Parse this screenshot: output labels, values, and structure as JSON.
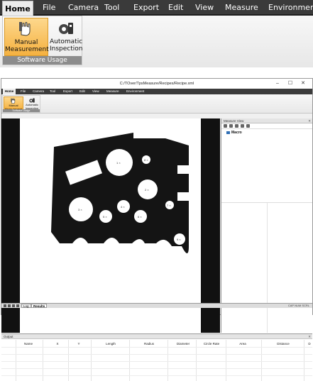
{
  "zoom": {
    "menu": [
      "Home",
      "File",
      "Camera",
      "Tool",
      "Export",
      "Edit",
      "View",
      "Measure",
      "Environment"
    ],
    "buttons": [
      {
        "label1": "Manual",
        "label2": "Measurement",
        "selected": true,
        "icon": "hand-measure-icon"
      },
      {
        "label1": "Automatic",
        "label2": "Inspection",
        "selected": false,
        "icon": "gear-camera-icon"
      }
    ],
    "group_label": "Software Usage"
  },
  "window": {
    "title": "C:/TOver/TpsMeasure/Recipes/Recipe.xml",
    "controls": [
      "–",
      "☐",
      "✕"
    ]
  },
  "menu": [
    "Home",
    "File",
    "Camera",
    "Tool",
    "Export",
    "Edit",
    "View",
    "Measure",
    "Environment"
  ],
  "ribbon": {
    "buttons": [
      {
        "label1": "Manual",
        "label2": "Measurement",
        "selected": true
      },
      {
        "label1": "Automatic",
        "label2": "Inspection",
        "selected": false
      }
    ],
    "group_label": "Software Usage"
  },
  "measure_view": {
    "header": "Measure View",
    "close": "✕",
    "tree_item": "Macro"
  },
  "image_labels": [
    "1 ×",
    "2 ×",
    "3 ×",
    "4 ×",
    "5 ×",
    "6 ×",
    "7 ×",
    "8 ×",
    "9 ×"
  ],
  "output": {
    "header": "Output",
    "close": "✕",
    "columns": [
      "Name",
      "X",
      "Y",
      "Length",
      "Radius",
      "Diameter",
      "Circle Rate",
      "Area",
      "Distance",
      "D"
    ]
  },
  "bottom_tabs": [
    "Log",
    "Results"
  ],
  "status": "CAP  NUM  SCRL",
  "colors": {
    "accent": "#f5b140",
    "menu_bg": "#3a3a3a",
    "part": "#141414"
  }
}
